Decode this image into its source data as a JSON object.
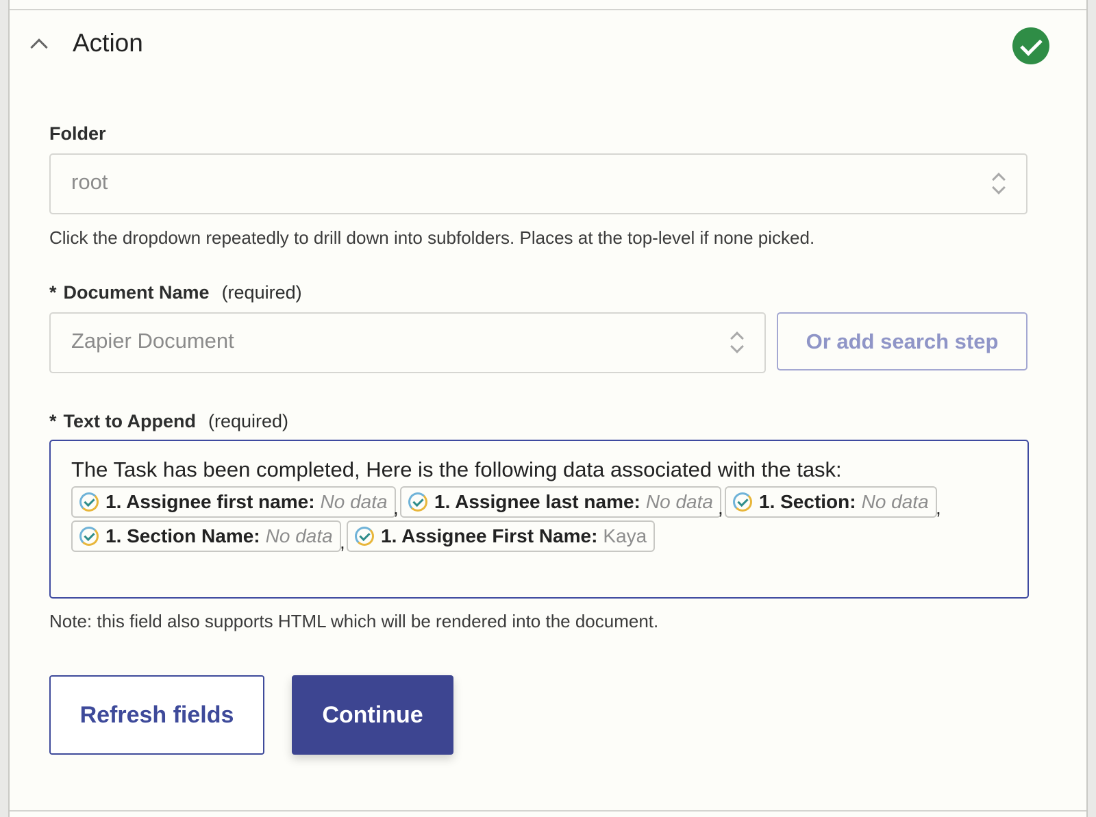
{
  "header": {
    "title": "Action",
    "status": "complete"
  },
  "folder": {
    "label": "Folder",
    "value": "root",
    "help": "Click the dropdown repeatedly to drill down into subfolders. Places at the top-level if none picked."
  },
  "document_name": {
    "star": "*",
    "label": "Document Name",
    "required": "(required)",
    "value": "Zapier Document",
    "search_step": "Or add search step"
  },
  "text_to_append": {
    "star": "*",
    "label": "Text to Append",
    "required": "(required)",
    "text": "The Task has been completed, Here is the following data associated with the task:",
    "pills": [
      {
        "key": "1. Assignee first name:",
        "value": "No data"
      },
      {
        "key": "1. Assignee last name:",
        "value": "No data"
      },
      {
        "key": "1. Section:",
        "value": "No data"
      },
      {
        "key": "1. Section Name:",
        "value": "No data"
      },
      {
        "key": "1. Assignee First Name:",
        "value": "Kaya"
      }
    ],
    "separator": ",",
    "note": "Note: this field also supports HTML which will be rendered into the document."
  },
  "buttons": {
    "refresh": "Refresh fields",
    "continue": "Continue"
  },
  "colors": {
    "accent": "#3d4591",
    "success": "#2f8d46"
  }
}
